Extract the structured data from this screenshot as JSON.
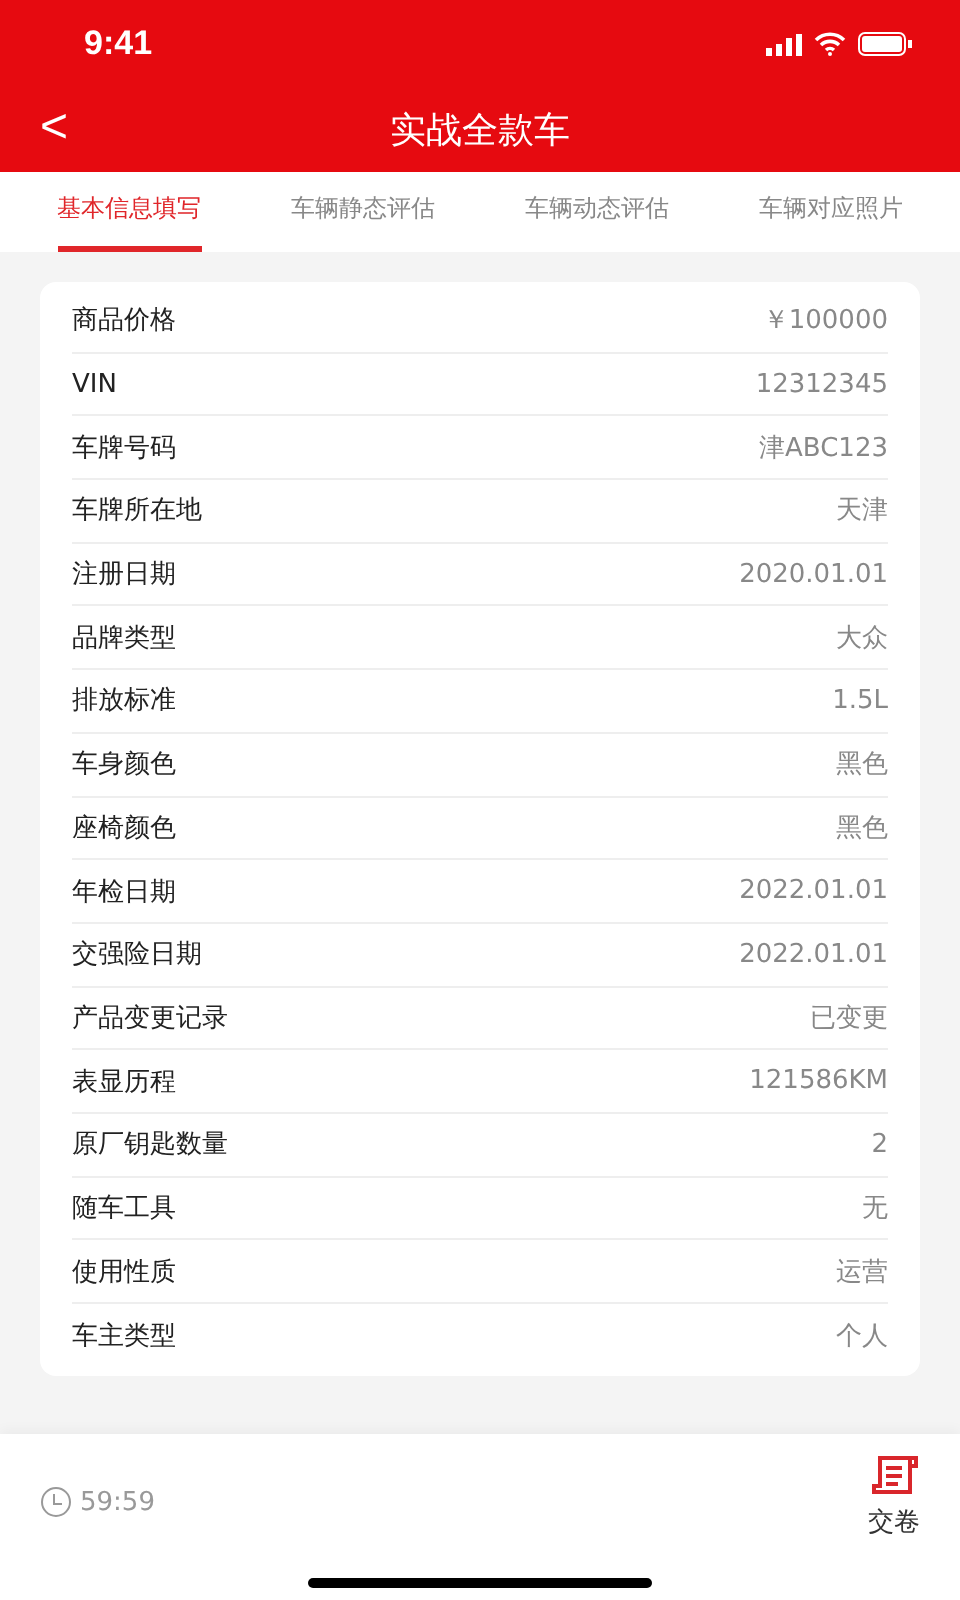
{
  "status_bar": {
    "time": "9:41"
  },
  "nav": {
    "back": "<",
    "title": "实战全款车"
  },
  "tabs": [
    {
      "label": "基本信息填写",
      "selected": true
    },
    {
      "label": "车辆静态评估",
      "selected": false
    },
    {
      "label": "车辆动态评估",
      "selected": false
    },
    {
      "label": "车辆对应照片",
      "selected": false
    }
  ],
  "fields": [
    {
      "label": "商品价格",
      "value": "￥100000"
    },
    {
      "label": "VIN",
      "value": "12312345"
    },
    {
      "label": "车牌号码",
      "value": "津ABC123"
    },
    {
      "label": "车牌所在地",
      "value": "天津"
    },
    {
      "label": "注册日期",
      "value": "2020.01.01"
    },
    {
      "label": "品牌类型",
      "value": "大众"
    },
    {
      "label": "排放标准",
      "value": "1.5L"
    },
    {
      "label": "车身颜色",
      "value": "黑色"
    },
    {
      "label": "座椅颜色",
      "value": "黑色"
    },
    {
      "label": "年检日期",
      "value": "2022.01.01"
    },
    {
      "label": "交强险日期",
      "value": "2022.01.01"
    },
    {
      "label": "产品变更记录",
      "value": "已变更"
    },
    {
      "label": "表显历程",
      "value": "121586KM"
    },
    {
      "label": "原厂钥匙数量",
      "value": "2"
    },
    {
      "label": "随车工具",
      "value": "无"
    },
    {
      "label": "使用性质",
      "value": "运营"
    },
    {
      "label": "车主类型",
      "value": "个人"
    }
  ],
  "footer": {
    "timer": "59:59",
    "submit": "交卷"
  }
}
